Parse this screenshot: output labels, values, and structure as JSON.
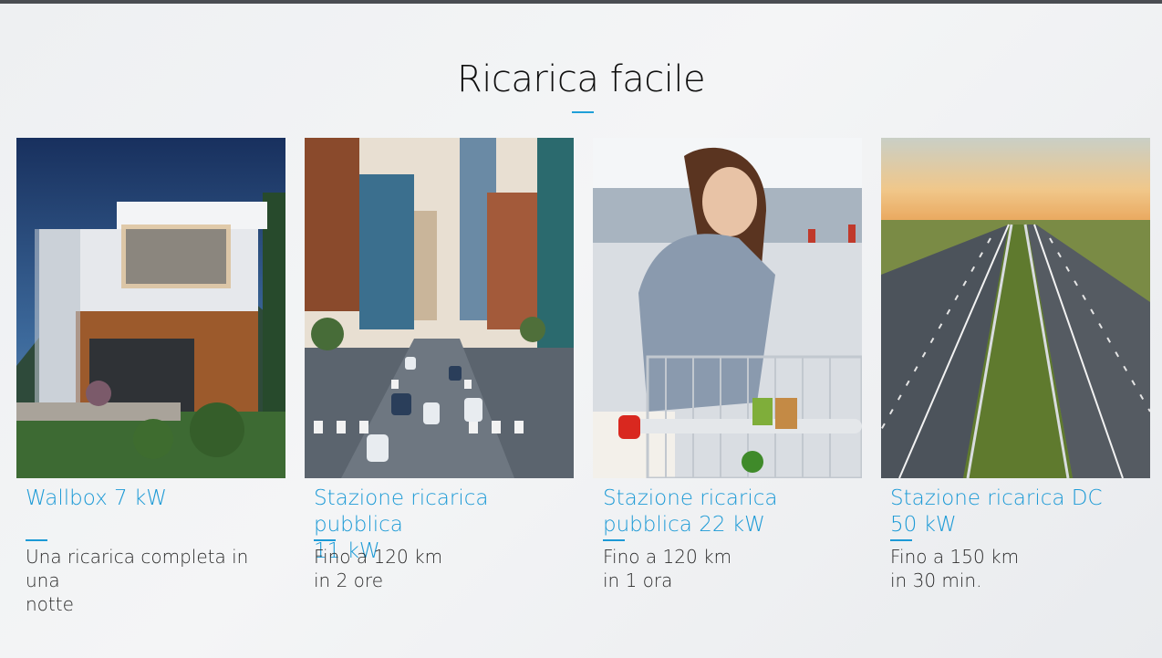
{
  "section": {
    "title": "Ricarica facile"
  },
  "colors": {
    "accent": "#1c9ad6",
    "top_bar": "#4a4d52"
  },
  "cards": [
    {
      "name": "Wallbox 7 kW",
      "desc_line1": "Una ricarica completa in una",
      "desc_line2": "notte",
      "image": "modern-house-at-dusk"
    },
    {
      "name_line1": "Stazione ricarica pubblica",
      "name_line2": "11 kW",
      "desc_line1": "Fino a 120 km",
      "desc_line2": "in 2 ore",
      "image": "city-street-traffic"
    },
    {
      "name_line1": "Stazione ricarica",
      "name_line2": "pubblica 22 kW",
      "desc_line1": "Fino a 120 km",
      "desc_line2": "in 1 ora",
      "image": "woman-with-shopping-cart"
    },
    {
      "name_line1": "Stazione ricarica DC",
      "name_line2": "50 kW",
      "desc_line1": "Fino a 150 km",
      "desc_line2": "in 30 min.",
      "image": "highway-at-sunset"
    }
  ]
}
